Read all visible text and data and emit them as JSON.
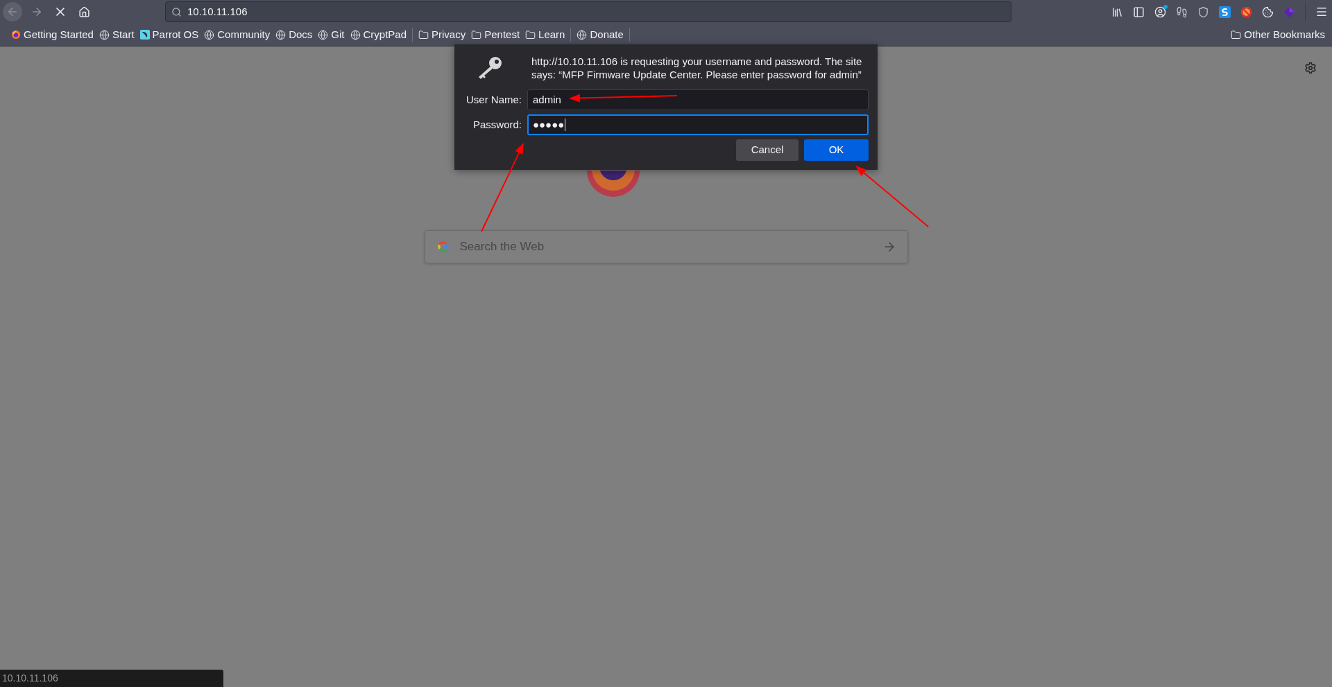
{
  "toolbar": {
    "address": "10.10.11.106"
  },
  "bookmarks": [
    {
      "kind": "firefox",
      "label": "Getting Started"
    },
    {
      "kind": "globe",
      "label": "Start"
    },
    {
      "kind": "parrot",
      "label": "Parrot OS"
    },
    {
      "kind": "globe",
      "label": "Community"
    },
    {
      "kind": "globe",
      "label": "Docs"
    },
    {
      "kind": "globe",
      "label": "Git"
    },
    {
      "kind": "globe",
      "label": "CryptPad"
    },
    {
      "kind": "separator"
    },
    {
      "kind": "folder",
      "label": "Privacy"
    },
    {
      "kind": "folder",
      "label": "Pentest"
    },
    {
      "kind": "folder",
      "label": "Learn"
    },
    {
      "kind": "separator"
    },
    {
      "kind": "globe",
      "label": "Donate"
    },
    {
      "kind": "separator"
    }
  ],
  "other_bookmarks": "Other Bookmarks",
  "dialog": {
    "message": "http://10.10.11.106 is requesting your username and password. The site says: “MFP Firmware Update Center. Please enter password for admin”",
    "fields": [
      {
        "label": "User Name:",
        "value": "admin",
        "focused": false
      },
      {
        "label": "Password:",
        "value": "●●●●●",
        "focused": true
      }
    ],
    "buttons": [
      {
        "label": "Cancel",
        "primary": false
      },
      {
        "label": "OK",
        "primary": true
      }
    ]
  },
  "newtab": {
    "search_placeholder": "Search the Web"
  },
  "status_bar": "10.10.11.106"
}
